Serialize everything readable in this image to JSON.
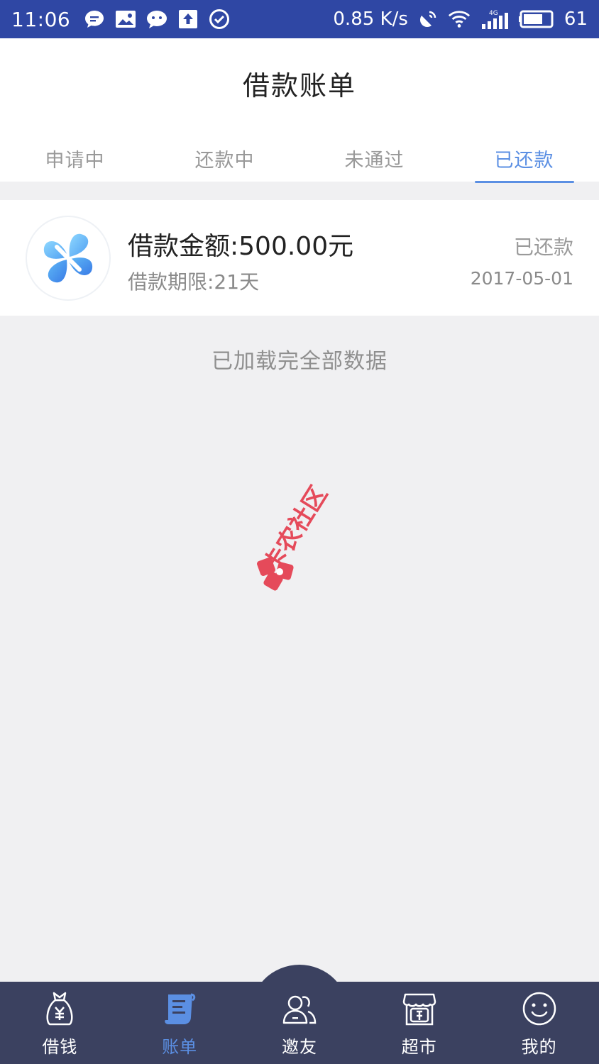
{
  "status_bar": {
    "time": "11:06",
    "speed": "0.85 K/s",
    "battery": "61",
    "network_label": "4G"
  },
  "header": {
    "title": "借款账单"
  },
  "tabs": [
    {
      "label": "申请中",
      "active": false
    },
    {
      "label": "还款中",
      "active": false
    },
    {
      "label": "未通过",
      "active": false
    },
    {
      "label": "已还款",
      "active": true
    }
  ],
  "loan": {
    "amount_text": "借款金额:500.00元",
    "term_text": "借款期限:21天",
    "status": "已还款",
    "date": "2017-05-01"
  },
  "list_footer": "已加载完全部数据",
  "watermark_text": "卡农社区",
  "bottom_nav": [
    {
      "label": "借钱",
      "icon": "money-bag-icon",
      "active": false
    },
    {
      "label": "账单",
      "icon": "bill-icon",
      "active": true
    },
    {
      "label": "邀友",
      "icon": "invite-friends-icon",
      "active": false
    },
    {
      "label": "超市",
      "icon": "market-icon",
      "active": false
    },
    {
      "label": "我的",
      "icon": "smile-icon",
      "active": false
    }
  ],
  "colors": {
    "status_bar": "#2f47a4",
    "accent": "#5b8fe3",
    "nav_bg": "#3b4160",
    "page_bg": "#f0f0f2"
  }
}
